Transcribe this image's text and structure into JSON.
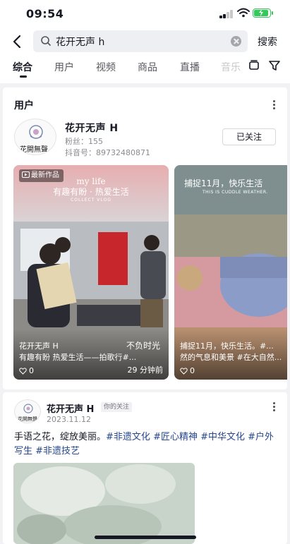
{
  "status_bar": {
    "time": "09:54"
  },
  "search": {
    "query": "花开无声 h",
    "submit_label": "搜索"
  },
  "tabs": [
    {
      "label": "综合"
    },
    {
      "label": "用户"
    },
    {
      "label": "视频"
    },
    {
      "label": "商品"
    },
    {
      "label": "直播"
    },
    {
      "label": "音乐"
    }
  ],
  "user_section": {
    "title": "用户",
    "user": {
      "name": "花开无声 H",
      "fans_label": "粉丝：",
      "fans": "155",
      "id_label": "抖音号：",
      "douyin_id": "89732480871",
      "follow_label": "已关注",
      "avatar_text": "花開無聲"
    },
    "videos": [
      {
        "badge": "最新作品",
        "overlay_text": "有趣有盼 · 热爱生活",
        "overlay_sub": "my life",
        "overlay_en": "COLLECT VLOG",
        "author": "花开无声 H",
        "desc": "有趣有盼 热爱生活——拍歌行#...",
        "likes": "0",
        "time": "29 分钟前",
        "handwriting": "不负时光"
      },
      {
        "overlay_text": "捕捉11月，快乐生活",
        "overlay_en": "THIS IS CUDDLE WEATHER.",
        "author": "捕捉11月，快乐生活。#...",
        "desc": "然的气息和美景 #在大自然...",
        "likes": "0"
      }
    ]
  },
  "post": {
    "author": "花开无声 H",
    "tag": "你的关注",
    "date": "2023.11.12",
    "text_lead": "手语之花，绽放美丽。",
    "hashtags": [
      "#非遗文化",
      "#匠心精神",
      "#中华文化",
      "#户外写生",
      "#非遗技艺"
    ]
  },
  "colors": {
    "text": "#161823",
    "secondary": "#8a8b91",
    "hashtag": "#26478c",
    "battery": "#34c759",
    "background": "#f2f2f4"
  }
}
